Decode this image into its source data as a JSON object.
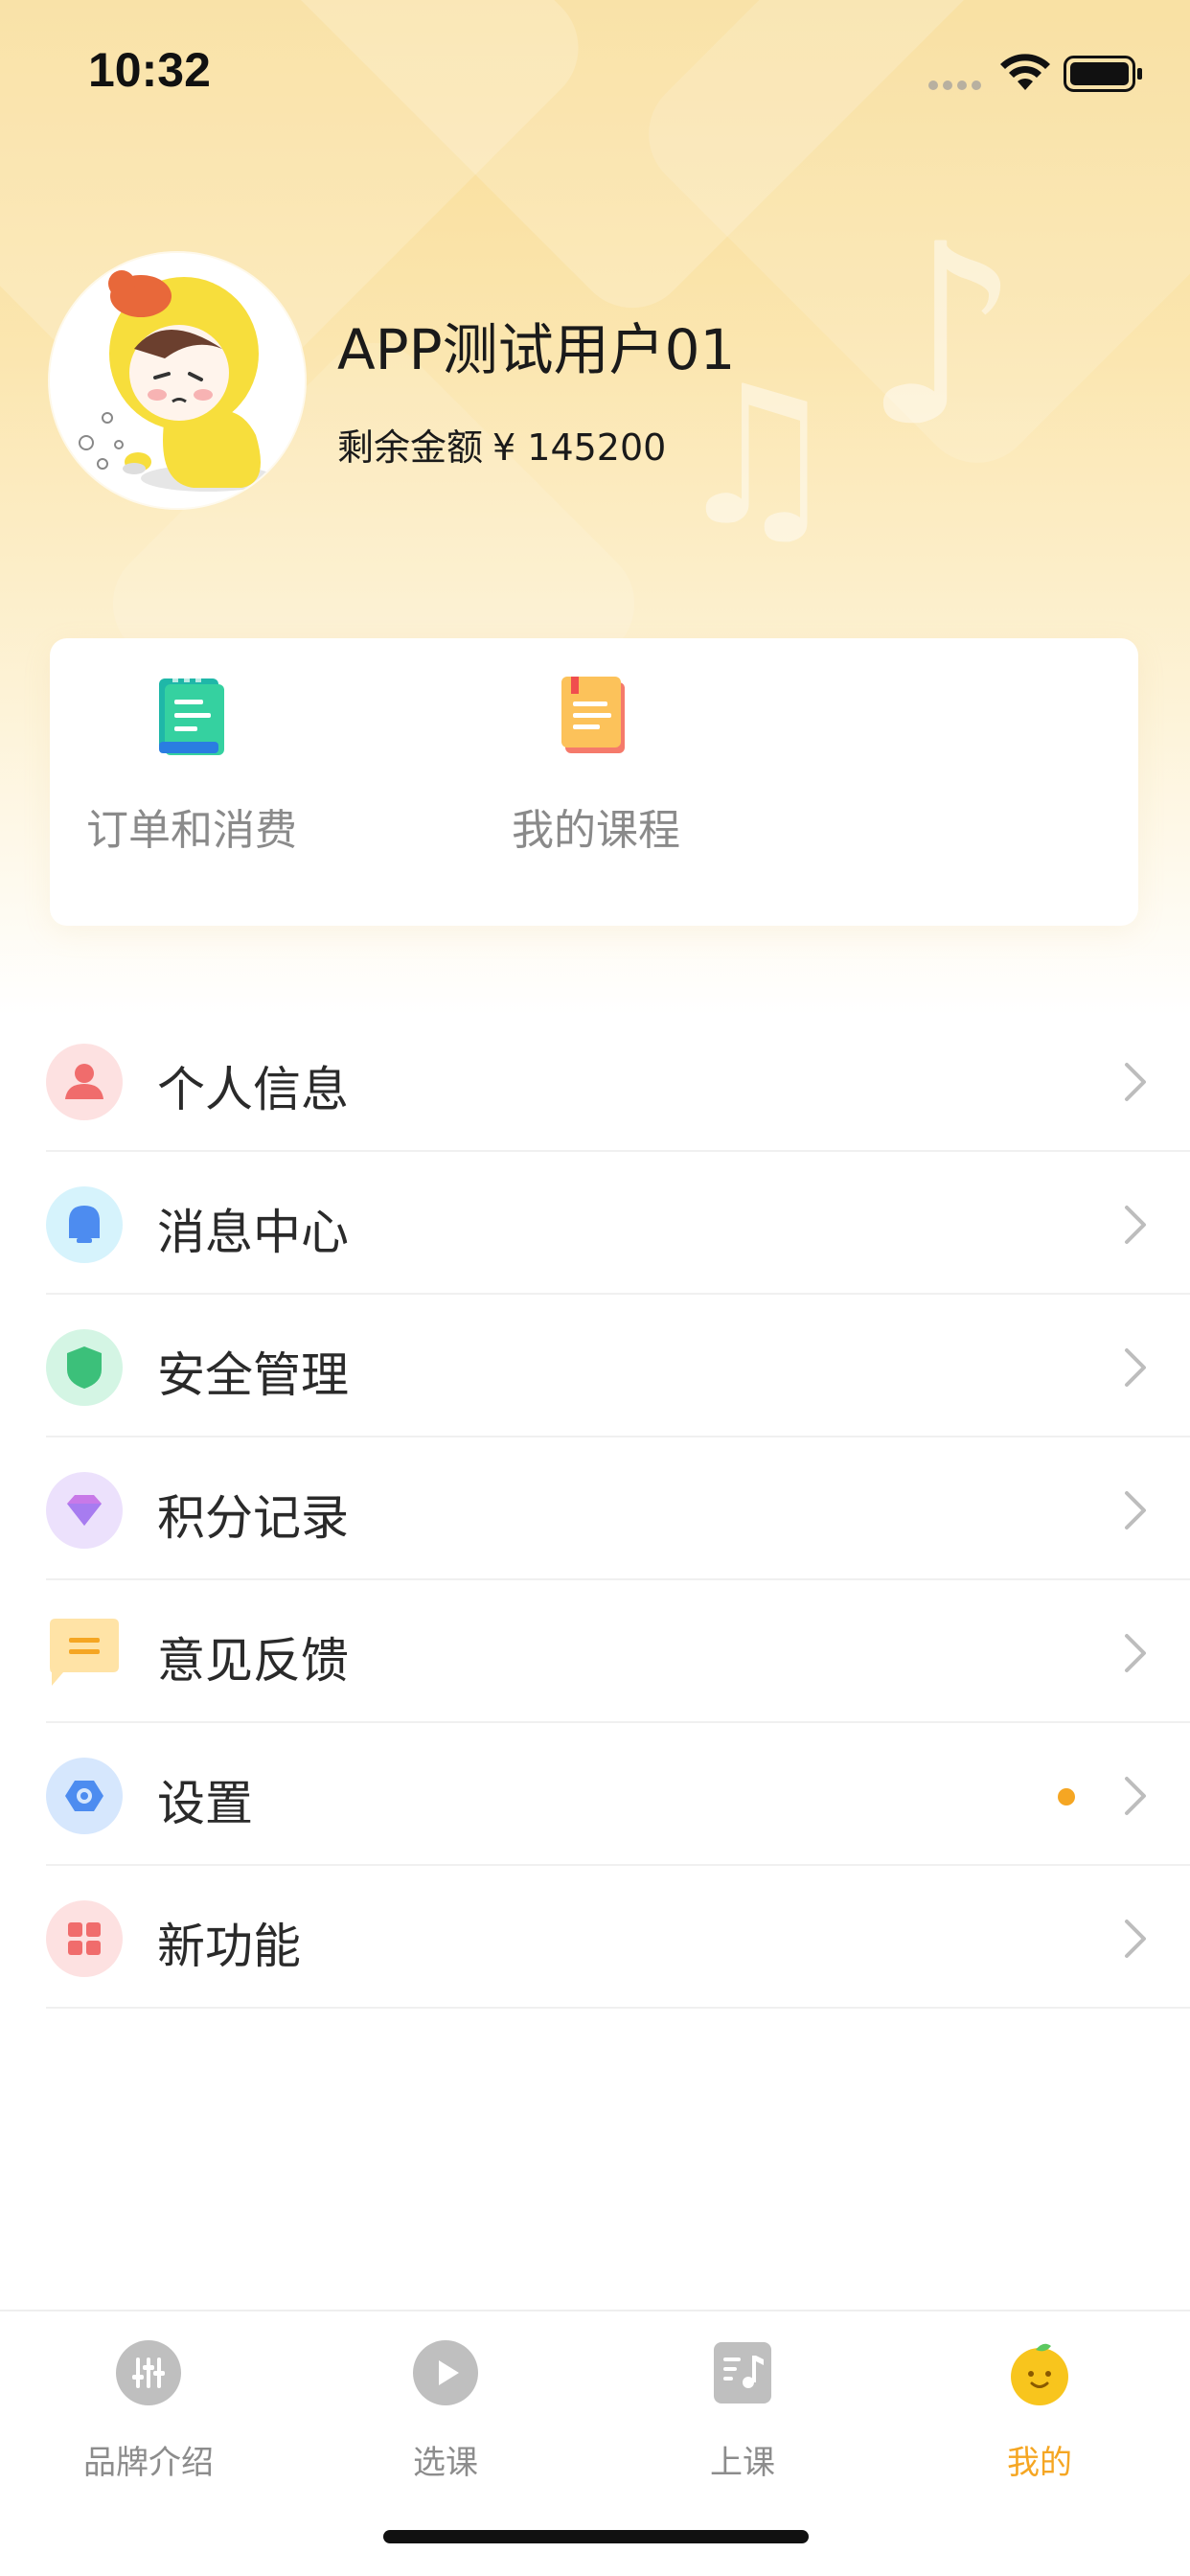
{
  "status_bar": {
    "time": "10:32"
  },
  "profile": {
    "name": "APP测试用户01",
    "balance_label": "剩余金额",
    "balance_value": "¥ 145200"
  },
  "quick_actions": [
    {
      "label": "订单和消费",
      "icon": "order-list-icon"
    },
    {
      "label": "我的课程",
      "icon": "course-book-icon"
    }
  ],
  "menu": [
    {
      "label": "个人信息",
      "icon": "person-icon",
      "color": "#f06c6c"
    },
    {
      "label": "消息中心",
      "icon": "bell-icon",
      "color": "#4d8cf0"
    },
    {
      "label": "安全管理",
      "icon": "shield-icon",
      "color": "#3cc07a"
    },
    {
      "label": "积分记录",
      "icon": "diamond-icon",
      "color": "#a77cf0"
    },
    {
      "label": "意见反馈",
      "icon": "chat-bubble-icon",
      "color": "#f5a623"
    },
    {
      "label": "设置",
      "icon": "gear-icon",
      "color": "#4d8cf0",
      "has_badge_dot": true
    },
    {
      "label": "新功能",
      "icon": "grid-icon",
      "color": "#f06c6c"
    }
  ],
  "tabs": [
    {
      "label": "品牌介绍",
      "icon": "sliders-icon",
      "active": false
    },
    {
      "label": "选课",
      "icon": "play-icon",
      "active": false
    },
    {
      "label": "上课",
      "icon": "music-note-icon",
      "active": false
    },
    {
      "label": "我的",
      "icon": "smiley-fruit-icon",
      "active": true
    }
  ],
  "colors": {
    "accent": "#f5a623",
    "header_gradient_top": "#f8dc95",
    "inactive_tab": "#8c8c8c"
  }
}
